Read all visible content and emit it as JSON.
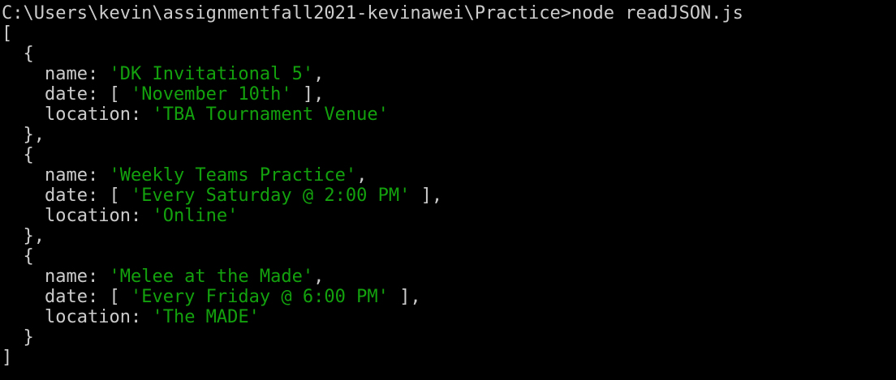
{
  "terminal": {
    "prompt": "C:\\Users\\kevin\\assignmentfall2021-kevinawei\\Practice>",
    "command": "node readJSON.js"
  },
  "colors": {
    "background": "#000000",
    "text": "#cccccc",
    "string": "#13a10e"
  },
  "output": {
    "array_open": "[",
    "array_close": "]",
    "object_open": "{",
    "object_close": "}",
    "object_close_comma": "},",
    "key_name": "name",
    "key_date": "date",
    "key_location": "location",
    "records": [
      {
        "name": "'DK Invitational 5'",
        "date": "'November 10th'",
        "location": "'TBA Tournament Venue'"
      },
      {
        "name": "'Weekly Teams Practice'",
        "date": "'Every Saturday @ 2:00 PM'",
        "location": "'Online'"
      },
      {
        "name": "'Melee at the Made'",
        "date": "'Every Friday @ 6:00 PM'",
        "location": "'The MADE'"
      }
    ]
  }
}
